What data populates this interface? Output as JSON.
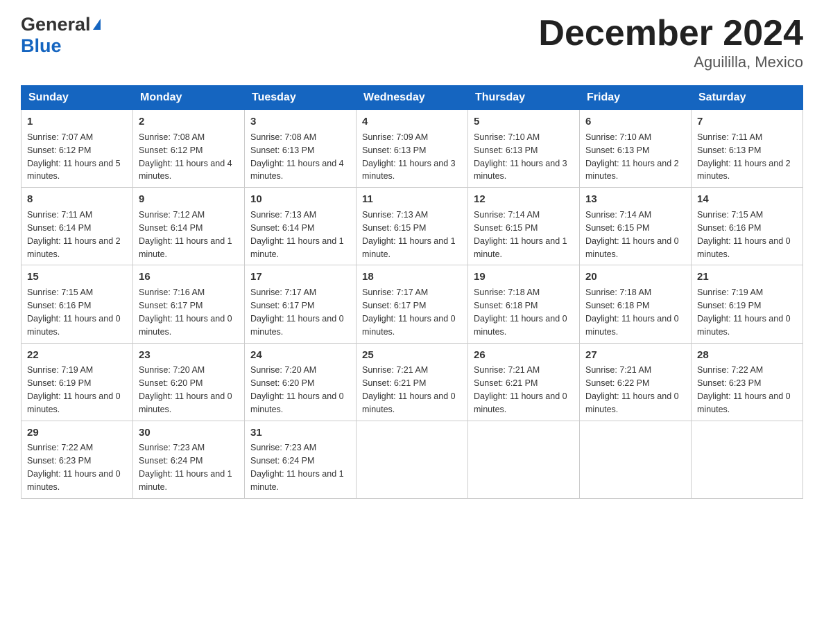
{
  "header": {
    "logo_general": "General",
    "logo_blue": "Blue",
    "title": "December 2024",
    "subtitle": "Aguililla, Mexico"
  },
  "days_of_week": [
    "Sunday",
    "Monday",
    "Tuesday",
    "Wednesday",
    "Thursday",
    "Friday",
    "Saturday"
  ],
  "weeks": [
    [
      {
        "num": "1",
        "sunrise": "7:07 AM",
        "sunset": "6:12 PM",
        "daylight": "11 hours and 5 minutes."
      },
      {
        "num": "2",
        "sunrise": "7:08 AM",
        "sunset": "6:12 PM",
        "daylight": "11 hours and 4 minutes."
      },
      {
        "num": "3",
        "sunrise": "7:08 AM",
        "sunset": "6:13 PM",
        "daylight": "11 hours and 4 minutes."
      },
      {
        "num": "4",
        "sunrise": "7:09 AM",
        "sunset": "6:13 PM",
        "daylight": "11 hours and 3 minutes."
      },
      {
        "num": "5",
        "sunrise": "7:10 AM",
        "sunset": "6:13 PM",
        "daylight": "11 hours and 3 minutes."
      },
      {
        "num": "6",
        "sunrise": "7:10 AM",
        "sunset": "6:13 PM",
        "daylight": "11 hours and 2 minutes."
      },
      {
        "num": "7",
        "sunrise": "7:11 AM",
        "sunset": "6:13 PM",
        "daylight": "11 hours and 2 minutes."
      }
    ],
    [
      {
        "num": "8",
        "sunrise": "7:11 AM",
        "sunset": "6:14 PM",
        "daylight": "11 hours and 2 minutes."
      },
      {
        "num": "9",
        "sunrise": "7:12 AM",
        "sunset": "6:14 PM",
        "daylight": "11 hours and 1 minute."
      },
      {
        "num": "10",
        "sunrise": "7:13 AM",
        "sunset": "6:14 PM",
        "daylight": "11 hours and 1 minute."
      },
      {
        "num": "11",
        "sunrise": "7:13 AM",
        "sunset": "6:15 PM",
        "daylight": "11 hours and 1 minute."
      },
      {
        "num": "12",
        "sunrise": "7:14 AM",
        "sunset": "6:15 PM",
        "daylight": "11 hours and 1 minute."
      },
      {
        "num": "13",
        "sunrise": "7:14 AM",
        "sunset": "6:15 PM",
        "daylight": "11 hours and 0 minutes."
      },
      {
        "num": "14",
        "sunrise": "7:15 AM",
        "sunset": "6:16 PM",
        "daylight": "11 hours and 0 minutes."
      }
    ],
    [
      {
        "num": "15",
        "sunrise": "7:15 AM",
        "sunset": "6:16 PM",
        "daylight": "11 hours and 0 minutes."
      },
      {
        "num": "16",
        "sunrise": "7:16 AM",
        "sunset": "6:17 PM",
        "daylight": "11 hours and 0 minutes."
      },
      {
        "num": "17",
        "sunrise": "7:17 AM",
        "sunset": "6:17 PM",
        "daylight": "11 hours and 0 minutes."
      },
      {
        "num": "18",
        "sunrise": "7:17 AM",
        "sunset": "6:17 PM",
        "daylight": "11 hours and 0 minutes."
      },
      {
        "num": "19",
        "sunrise": "7:18 AM",
        "sunset": "6:18 PM",
        "daylight": "11 hours and 0 minutes."
      },
      {
        "num": "20",
        "sunrise": "7:18 AM",
        "sunset": "6:18 PM",
        "daylight": "11 hours and 0 minutes."
      },
      {
        "num": "21",
        "sunrise": "7:19 AM",
        "sunset": "6:19 PM",
        "daylight": "11 hours and 0 minutes."
      }
    ],
    [
      {
        "num": "22",
        "sunrise": "7:19 AM",
        "sunset": "6:19 PM",
        "daylight": "11 hours and 0 minutes."
      },
      {
        "num": "23",
        "sunrise": "7:20 AM",
        "sunset": "6:20 PM",
        "daylight": "11 hours and 0 minutes."
      },
      {
        "num": "24",
        "sunrise": "7:20 AM",
        "sunset": "6:20 PM",
        "daylight": "11 hours and 0 minutes."
      },
      {
        "num": "25",
        "sunrise": "7:21 AM",
        "sunset": "6:21 PM",
        "daylight": "11 hours and 0 minutes."
      },
      {
        "num": "26",
        "sunrise": "7:21 AM",
        "sunset": "6:21 PM",
        "daylight": "11 hours and 0 minutes."
      },
      {
        "num": "27",
        "sunrise": "7:21 AM",
        "sunset": "6:22 PM",
        "daylight": "11 hours and 0 minutes."
      },
      {
        "num": "28",
        "sunrise": "7:22 AM",
        "sunset": "6:23 PM",
        "daylight": "11 hours and 0 minutes."
      }
    ],
    [
      {
        "num": "29",
        "sunrise": "7:22 AM",
        "sunset": "6:23 PM",
        "daylight": "11 hours and 0 minutes."
      },
      {
        "num": "30",
        "sunrise": "7:23 AM",
        "sunset": "6:24 PM",
        "daylight": "11 hours and 1 minute."
      },
      {
        "num": "31",
        "sunrise": "7:23 AM",
        "sunset": "6:24 PM",
        "daylight": "11 hours and 1 minute."
      },
      null,
      null,
      null,
      null
    ]
  ]
}
